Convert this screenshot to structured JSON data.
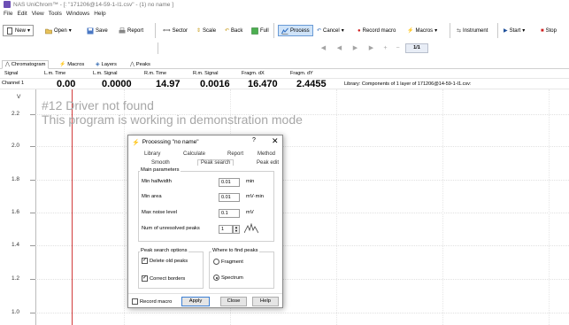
{
  "window": {
    "title": "NAS UniChrom™ - [: \"171206@14-59-1-I1.csv\" - (1) no name ]"
  },
  "menu": {
    "items": [
      "File",
      "Edit",
      "View",
      "Tools",
      "Windows",
      "Help"
    ]
  },
  "toolbar": {
    "new": "New",
    "open": "Open",
    "save": "Save",
    "report": "Report",
    "sector": "Sector",
    "scale": "Scale",
    "back": "Back",
    "full": "Full",
    "process": "Process",
    "cancel": "Cancel",
    "record_macro": "Record macro",
    "macros": "Macros",
    "instrument": "Instrument",
    "start": "Start",
    "stop": "Stop",
    "page": "1/1"
  },
  "tabs": {
    "items": [
      "Chromatogram",
      "Macros",
      "Layers",
      "Peaks"
    ]
  },
  "info": {
    "headers": {
      "signal": "Signal",
      "lm_time": "L.m. Time",
      "lm_signal": "L.m. Signal",
      "rm_time": "R.m. Time",
      "rm_signal": "R.m. Signal",
      "fragm_dx": "Fragm. dX",
      "fragm_dy": "Fragm. dY"
    },
    "channel": "Channel 1",
    "lm_time": "0.00",
    "lm_signal": "0.0000",
    "rm_time": "14.97",
    "rm_signal": "0.0016",
    "fragm_dx": "16.470",
    "fragm_dy": "2.4455",
    "library": "Library: Components of 1 layer of 171206@14-59-1-I1.csv:"
  },
  "plot": {
    "y_axis_label": "V",
    "y_ticks": [
      "2.2",
      "2.0",
      "1.8",
      "1.6",
      "1.4",
      "1.2",
      "1.0"
    ],
    "demo_line1": "#12 Driver not found",
    "demo_line2": "This program is working in demonstration mode"
  },
  "dialog": {
    "title": "Processing \"no name\"",
    "help": "?",
    "close": "✕",
    "tabs_row1": [
      "Library",
      "Calculate",
      "Report",
      "Method"
    ],
    "tabs_row2": [
      "Smooth",
      "Peak search",
      "Peak edit"
    ],
    "main_params": "Main parameters",
    "fields": [
      {
        "label": "Min halfwidth",
        "value": "0.01",
        "unit": "min"
      },
      {
        "label": "Min area",
        "value": "0.01",
        "unit": "mV·min"
      },
      {
        "label": "Max noise level",
        "value": "0.1",
        "unit": "mV"
      },
      {
        "label": "Num of unresolved peaks",
        "value": "1",
        "unit": ""
      }
    ],
    "search_options": "Peak search options",
    "delete_old": "Delete old peaks",
    "correct_borders": "Correct borders",
    "where": "Where to find peaks",
    "fragment": "Fragment",
    "spectrum": "Spectrum",
    "record_macro": "Record macro",
    "apply": "Apply",
    "close_btn": "Close",
    "help_btn": "Help"
  },
  "colors": {
    "accent": "#3c7fd3",
    "marker": "#d23b3b",
    "stop": "#d02020"
  }
}
